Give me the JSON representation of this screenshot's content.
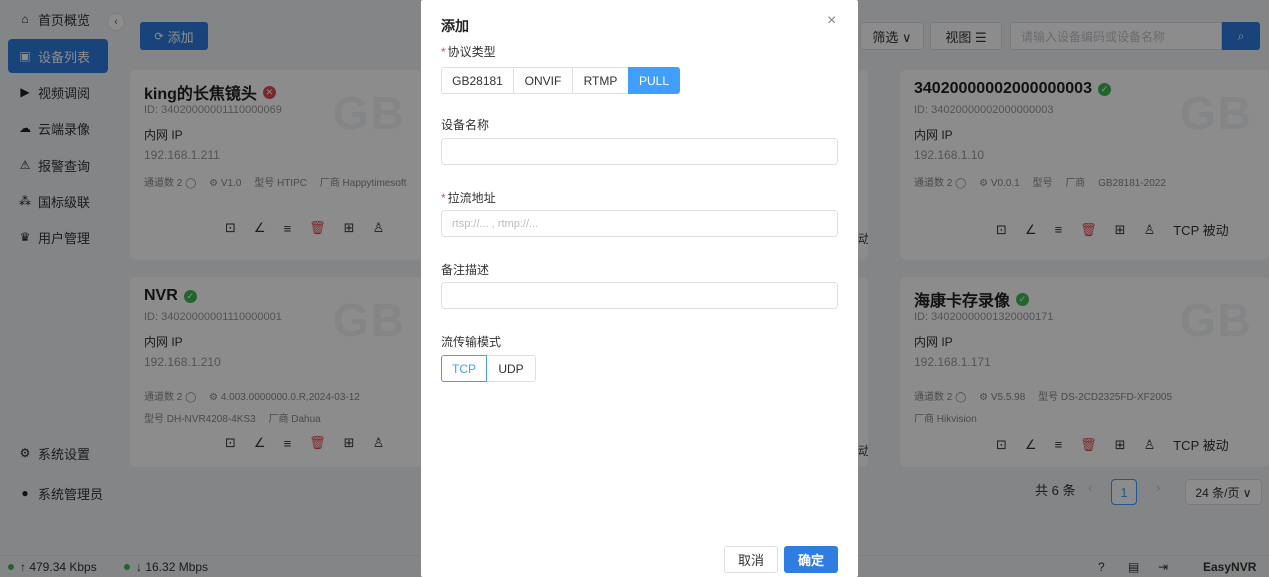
{
  "sidebar": {
    "items": [
      {
        "label": "首页概览",
        "icon": "home-icon",
        "glyph": "⌂"
      },
      {
        "label": "设备列表",
        "icon": "device-list-icon",
        "glyph": "▣"
      },
      {
        "label": "视频调阅",
        "icon": "video-play-icon",
        "glyph": "▶"
      },
      {
        "label": "云端录像",
        "icon": "cloud-icon",
        "glyph": "☁"
      },
      {
        "label": "报警查询",
        "icon": "alarm-icon",
        "glyph": "⚠"
      },
      {
        "label": "国标级联",
        "icon": "cascade-icon",
        "glyph": "⁂"
      },
      {
        "label": "用户管理",
        "icon": "user-manage-icon",
        "glyph": "♛"
      }
    ],
    "settings": {
      "label": "系统设置",
      "glyph": "⚙"
    },
    "admin": {
      "label": "系统管理员",
      "glyph": "●"
    },
    "collapse_glyph": "‹"
  },
  "toolbar": {
    "add_label": "添加",
    "add_glyph": "⟳",
    "filter_label": "筛选 ∨",
    "view_label": "视图 ☰",
    "search_placeholder": "请输入设备编码或设备名称",
    "search_glyph": "⌕"
  },
  "cards": [
    {
      "title": "king的长焦镜头",
      "status": "error",
      "status_glyph": "✕",
      "id": "ID: 34020000001110000069",
      "net_label": "内网 IP",
      "ip": "192.168.1.211",
      "meta1": [
        "通道数 2 ◯",
        "⚙ V1.0",
        "型号 HTIPC",
        "厂商 Happytimesoft"
      ],
      "meta2": [],
      "actions": [
        "⊡",
        "∠",
        "≡",
        "🗑",
        "⊞",
        "♙"
      ],
      "transport": ""
    },
    {
      "title": "34020000002000000003",
      "status": "ok",
      "status_glyph": "✓",
      "id": "ID: 34020000002000000003",
      "net_label": "内网 IP",
      "ip": "192.168.1.10",
      "meta1": [
        "通道数 2 ◯",
        "⚙ V0.0.1",
        "型号",
        "厂商",
        "GB28181-2022"
      ],
      "meta2": [],
      "actions": [
        "⊡",
        "∠",
        "≡",
        "🗑",
        "⊞",
        "♙"
      ],
      "transport": "TCP 被动"
    },
    {
      "title": "NVR",
      "status": "ok",
      "status_glyph": "✓",
      "id": "ID: 34020000001110000001",
      "net_label": "内网 IP",
      "ip": "192.168.1.210",
      "meta1": [
        "通道数 2 ◯",
        "⚙ 4.003.0000000.0.R,2024-03-12"
      ],
      "meta2": [
        "型号 DH-NVR4208-4KS3",
        "厂商 Dahua"
      ],
      "actions": [
        "⊡",
        "∠",
        "≡",
        "🗑",
        "⊞",
        "♙"
      ],
      "transport": ""
    },
    {
      "title": "海康卡存录像",
      "status": "ok",
      "status_glyph": "✓",
      "id": "ID: 34020000001320000171",
      "net_label": "内网 IP",
      "ip": "192.168.1.171",
      "meta1": [
        "通道数 2 ◯",
        "⚙ V5.5.98",
        "型号 DS-2CD2325FD-XF2005"
      ],
      "meta2": [
        "厂商 Hikvision"
      ],
      "actions": [
        "⊡",
        "∠",
        "≡",
        "🗑",
        "⊞",
        "♙"
      ],
      "transport": "TCP 被动"
    }
  ],
  "watermark": "GB",
  "partial_transport": "动",
  "pagination": {
    "total": "共 6 条",
    "prev": "‹",
    "current": "1",
    "next": "›",
    "page_size": "24 条/页 ∨"
  },
  "footer": {
    "upload": "↑ 479.34 Kbps",
    "download": "↓ 16.32 Mbps",
    "help_glyph": "?",
    "doc_glyph": "▤",
    "logout_glyph": "⇥",
    "brand": "EasyNVR"
  },
  "modal": {
    "title": "添加",
    "close_glyph": "×",
    "protocol_label": "协议类型",
    "protocols": [
      "GB28181",
      "ONVIF",
      "RTMP",
      "PULL"
    ],
    "protocol_selected": "PULL",
    "name_label": "设备名称",
    "name_value": "",
    "url_label": "拉流地址",
    "url_placeholder": "rtsp://... , rtmp://...",
    "desc_label": "备注描述",
    "desc_value": "",
    "transport_label": "流传输模式",
    "transports": [
      "TCP",
      "UDP"
    ],
    "transport_selected": "TCP",
    "cancel_label": "取消",
    "ok_label": "确定",
    "required_mark": "*"
  }
}
